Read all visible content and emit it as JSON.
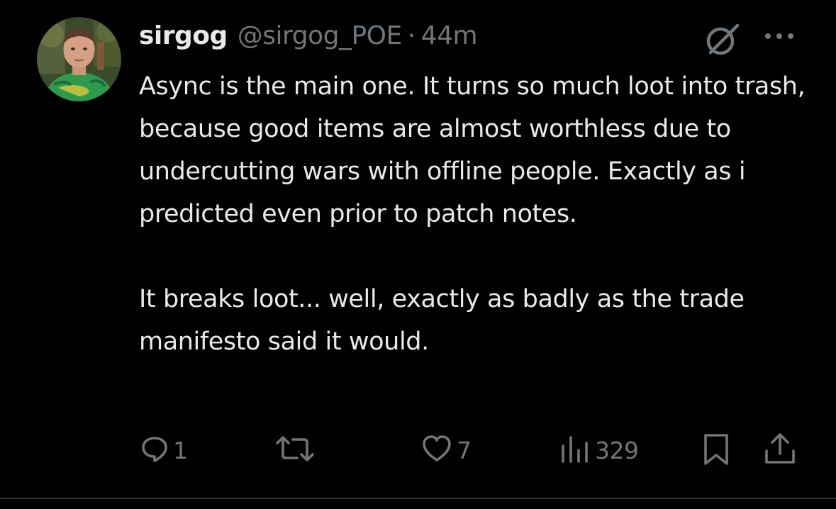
{
  "post": {
    "display_name": "sirgog",
    "handle": "@sirgog_POE",
    "separator": "·",
    "time": "44m",
    "body": "Async is the main one. It turns so much loot into trash, because good items are almost worthless due to undercutting wars with offline people. Exactly as i predicted even prior to patch notes.\n\nIt breaks loot... well, exactly as badly as the trade manifesto said it would."
  },
  "actions": {
    "reply_count": "1",
    "retweet_count": "",
    "like_count": "7",
    "views_count": "329"
  },
  "icons": {
    "reply": "reply-icon",
    "retweet": "retweet-icon",
    "like": "heart-icon",
    "views": "views-icon",
    "bookmark": "bookmark-icon",
    "share": "share-icon",
    "grok": "grok-icon",
    "more": "more-icon"
  },
  "colors": {
    "background": "#000000",
    "text": "#e7e9ea",
    "secondary": "#71767b",
    "divider": "#2f3336"
  }
}
